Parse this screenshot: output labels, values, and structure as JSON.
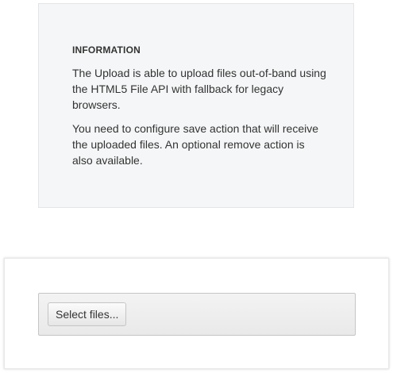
{
  "info": {
    "heading": "INFORMATION",
    "paragraph1": "The Upload is able to upload files out-of-band using the HTML5 File API with fallback for legacy browsers.",
    "paragraph2": "You need to configure save action that will receive the uploaded files. An optional remove action is also available."
  },
  "upload": {
    "select_button_label": "Select files..."
  }
}
